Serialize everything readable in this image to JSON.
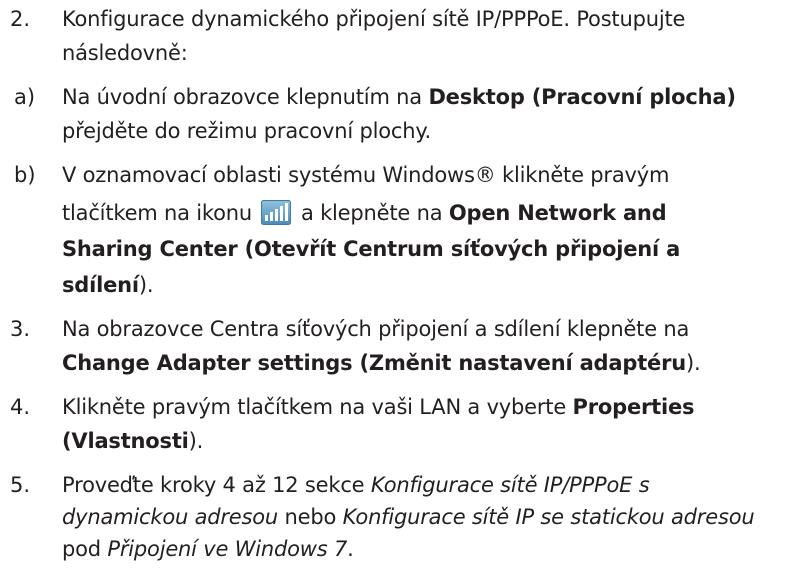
{
  "steps": [
    {
      "marker": "2.",
      "lines": [
        [
          "Konfigurace dynamického připojení sítě IP/PPPoE. Postupujte"
        ],
        [
          "následovně:"
        ]
      ]
    },
    {
      "marker": "a)",
      "parts": {
        "l1_a": "Na úvodní obrazovce klepnutím na ",
        "l1_b": "Desktop (Pracovní plocha)",
        "l2": "přejděte do režimu pracovní plochy."
      }
    },
    {
      "marker": "b)",
      "parts": {
        "l1": "V oznamovací oblasti systému Windows® klikněte pravým",
        "l2_a": "tlačítkem na ikonu ",
        "l2_b": " a klepněte na ",
        "l2_c": "Open Network and",
        "l3": "Sharing Center (Otevřít Centrum síťových připojení a",
        "l4_a": "sdílení",
        "l4_b": ")."
      }
    },
    {
      "marker": "3.",
      "parts": {
        "l1": "Na obrazovce Centra síťových připojení a sdílení klepněte na",
        "l2_a": "Change Adapter settings (Změnit nastavení adaptéru",
        "l2_b": ")."
      }
    },
    {
      "marker": "4.",
      "parts": {
        "l1_a": "Klikněte pravým tlačítkem na vaši LAN a vyberte ",
        "l1_b": "Properties",
        "l2_a": "(Vlastnosti",
        "l2_b": ")."
      }
    },
    {
      "marker": "5.",
      "parts": {
        "l1_a": "Proveďte kroky 4 až 12 sekce ",
        "l1_b": "Konfigurace sítě IP/PPPoE s",
        "l2_a": "dynamickou adresou",
        "l2_b": " nebo ",
        "l2_c": "Konfigurace sítě IP se statickou adresou",
        "l3_a": "pod ",
        "l3_b": "Připojení ve Windows 7",
        "l3_c": "."
      }
    }
  ],
  "icon": "network-signal-icon"
}
